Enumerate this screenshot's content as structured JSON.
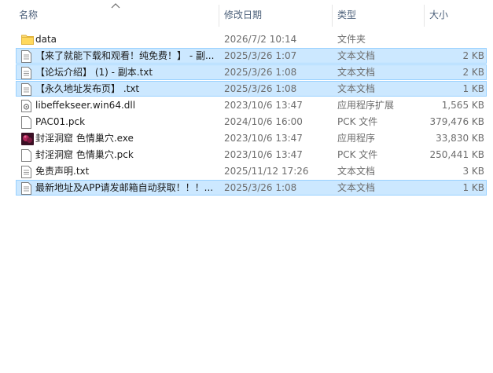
{
  "columns": {
    "name": "名称",
    "date": "修改日期",
    "type": "类型",
    "size": "大小"
  },
  "files": [
    {
      "name": "data",
      "date": "2026/7/2 10:14",
      "type": "文件夹",
      "size": "",
      "icon": "folder-icon",
      "selected": false
    },
    {
      "name": "【来了就能下载和观看！纯免费！】 - 副...",
      "date": "2025/3/26 1:07",
      "type": "文本文档",
      "size": "2 KB",
      "icon": "text-file-icon",
      "selected": true
    },
    {
      "name": "【论坛介绍】 (1) - 副本.txt",
      "date": "2025/3/26 1:08",
      "type": "文本文档",
      "size": "2 KB",
      "icon": "text-file-icon",
      "selected": true
    },
    {
      "name": "【永久地址发布页】 .txt",
      "date": "2025/3/26 1:08",
      "type": "文本文档",
      "size": "1 KB",
      "icon": "text-file-icon",
      "selected": true
    },
    {
      "name": "libeffekseer.win64.dll",
      "date": "2023/10/6 13:47",
      "type": "应用程序扩展",
      "size": "1,565 KB",
      "icon": "dll-file-icon",
      "selected": false
    },
    {
      "name": "PAC01.pck",
      "date": "2024/10/6 16:00",
      "type": "PCK 文件",
      "size": "379,476 KB",
      "icon": "generic-file-icon",
      "selected": false
    },
    {
      "name": "封淫洞窟 色情巢穴.exe",
      "date": "2023/10/6 13:47",
      "type": "应用程序",
      "size": "33,830 KB",
      "icon": "app-icon",
      "selected": false
    },
    {
      "name": "封淫洞窟 色情巢穴.pck",
      "date": "2023/10/6 13:47",
      "type": "PCK 文件",
      "size": "250,441 KB",
      "icon": "generic-file-icon",
      "selected": false
    },
    {
      "name": "免责声明.txt",
      "date": "2025/11/12 17:26",
      "type": "文本文档",
      "size": "3 KB",
      "icon": "text-file-icon",
      "selected": false
    },
    {
      "name": "最新地址及APP请发邮箱自动获取！！！...",
      "date": "2025/3/26 1:08",
      "type": "文本文档",
      "size": "1 KB",
      "icon": "text-file-icon",
      "selected": true
    }
  ]
}
